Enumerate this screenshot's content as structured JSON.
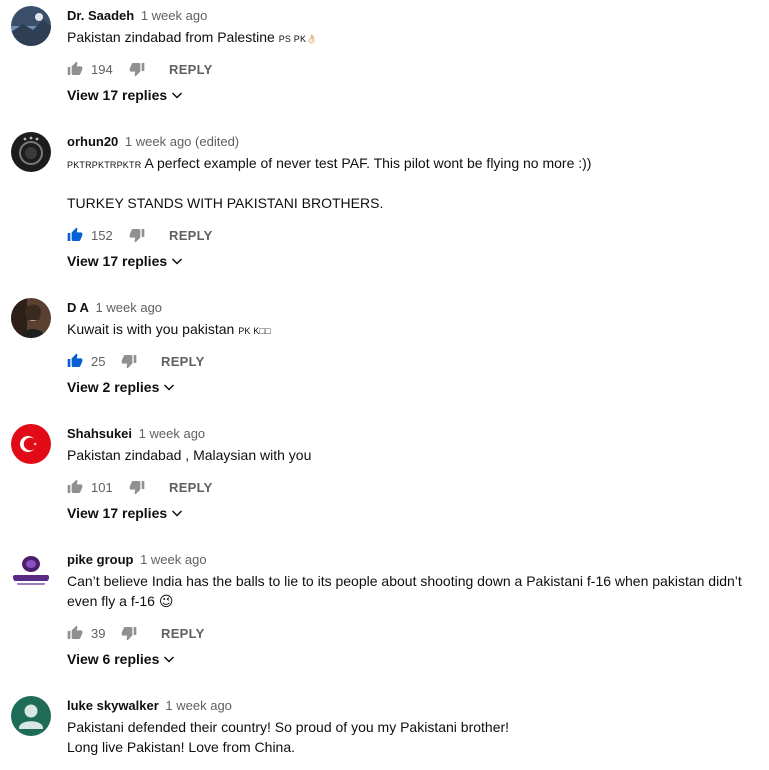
{
  "colors": {
    "like_active": "#065fd4",
    "icon_default": "#909090",
    "text_primary": "#0f0f0f",
    "text_secondary": "#606060"
  },
  "reply_label": "REPLY",
  "comments": [
    {
      "author": "Dr. Saadeh",
      "time": "1 week ago",
      "edited": "",
      "text": "Pakistan zindabad from Palestine",
      "text_suffix": "PS PK👌🏻",
      "text_line2": "",
      "likes": "194",
      "liked": false,
      "view_replies": "View 17 replies",
      "avatar": "landscape-photo"
    },
    {
      "author": "orhun20",
      "time": "1 week ago",
      "edited": "(edited)",
      "text_prefix": "PKTRPKTRPKTR",
      "text": "A perfect example of never test PAF. This pilot wont be flying no more :))",
      "text_line2": "TURKEY STANDS WITH PAKISTANI BROTHERS.",
      "likes": "152",
      "liked": true,
      "view_replies": "View 17 replies",
      "avatar": "dark-emblem"
    },
    {
      "author": "D A",
      "time": "1 week ago",
      "edited": "",
      "text": "Kuwait is with you pakistan",
      "text_suffix": "PK K□□",
      "text_line2": "",
      "likes": "25",
      "liked": true,
      "view_replies": "View 2 replies",
      "avatar": "portrait-photo"
    },
    {
      "author": "Shahsukei",
      "time": "1 week ago",
      "edited": "",
      "text": "Pakistan zindabad , Malaysian with you",
      "text_line2": "",
      "likes": "101",
      "liked": false,
      "view_replies": "View 17 replies",
      "avatar": "turkey-flag"
    },
    {
      "author": "pike group",
      "time": "1 week ago",
      "edited": "",
      "text": "Can’t believe India has the balls to lie to its people about shooting down a Pakistani f-16 when pakistan didn’t even fly a f-16 😉",
      "text_line2": "",
      "likes": "39",
      "liked": false,
      "view_replies": "View 6 replies",
      "avatar": "purple-logo"
    },
    {
      "author": "luke skywalker",
      "time": "1 week ago",
      "edited": "",
      "text": "Pakistani defended their country!  So proud of you my Pakistani brother!",
      "text_line2": "Long live Pakistan! Love from China.",
      "likes": "",
      "liked": false,
      "view_replies": "",
      "avatar": "default-person"
    }
  ]
}
